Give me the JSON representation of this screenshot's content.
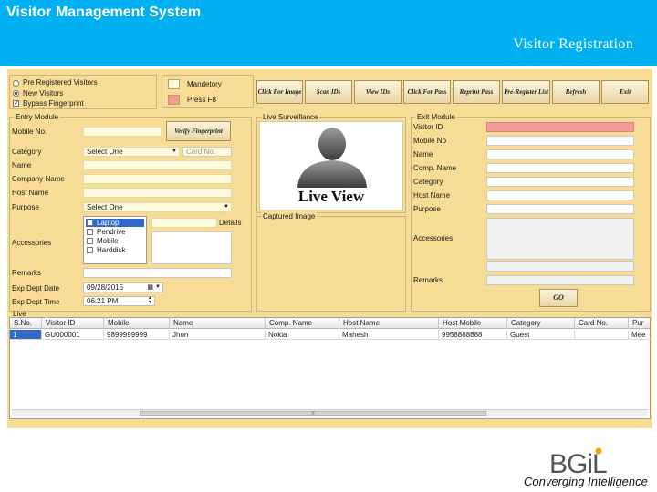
{
  "banner": {
    "title": "Visitor Management System",
    "subtitle": "Visitor Registration"
  },
  "options": {
    "radio_pre": "Pre Registered Visitors",
    "radio_new": "New Visitors",
    "bypass": "Bypass Fingerprint"
  },
  "legend": {
    "mandatory": "Mandetory",
    "press_f8": "Press F8"
  },
  "toolbar": {
    "click_image": "Click For Image",
    "scan_ids": "Scan IDs",
    "view_ids": "View IDs",
    "click_pass": "Click For Pass",
    "reprint_pass": "Reprint Pass",
    "pre_register_list": "Pre-Register List",
    "refresh": "Refresh",
    "exit": "Exit"
  },
  "entry": {
    "title": "Entry Module",
    "mobile_label": "Mobile No.",
    "verify_label": "Verify Fingerprint",
    "category_label": "Category",
    "category_value": "Select One",
    "card_no_placeholder": "Card No.",
    "name_label": "Name",
    "company_label": "Company Name",
    "host_label": "Host Name",
    "purpose_label": "Purpose",
    "purpose_value": "Select One",
    "details_label": "Details",
    "accessories_label": "Accessories",
    "accessories": [
      "Laptop",
      "Pendrive",
      "Mobile",
      "Harddisk"
    ],
    "remarks_label": "Remarks",
    "exp_date_label": "Exp Dept Date",
    "exp_date_value": "09/28/2015",
    "exp_time_label": "Exp Dept Time",
    "exp_time_value": "06:21 PM"
  },
  "surveillance": {
    "title": "Live Surveillance",
    "live_view": "Live View",
    "captured_title": "Captured Image"
  },
  "exit_module": {
    "title": "Exit Module",
    "visitor_id": "Visitor ID",
    "mobile": "Mobile No",
    "name": "Name",
    "company": "Comp. Name",
    "category": "Category",
    "host": "Host Name",
    "purpose": "Purpose",
    "accessories": "Accessories",
    "remarks": "Remarks",
    "go": "GO"
  },
  "live": {
    "title": "Live",
    "columns": [
      "S.No.",
      "Visitor ID",
      "Mobile",
      "Name",
      "Comp. Name",
      "Host Name",
      "Host Mobile",
      "Category",
      "Card No.",
      "Pur"
    ],
    "rows": [
      [
        "1",
        "GU000001",
        "9899999999",
        "Jhon",
        "Nokia",
        "Mahesh",
        "9958888888",
        "Guest",
        "",
        "Mee"
      ]
    ]
  },
  "logo": {
    "text": "BGiL",
    "tagline": "Converging Intelligence"
  },
  "colors": {
    "banner": "#00b0f0",
    "form_bg": "#f7dc95",
    "mandatory": "#fffbdc",
    "press_f8": "#f49a9a",
    "selection": "#3169c6"
  }
}
